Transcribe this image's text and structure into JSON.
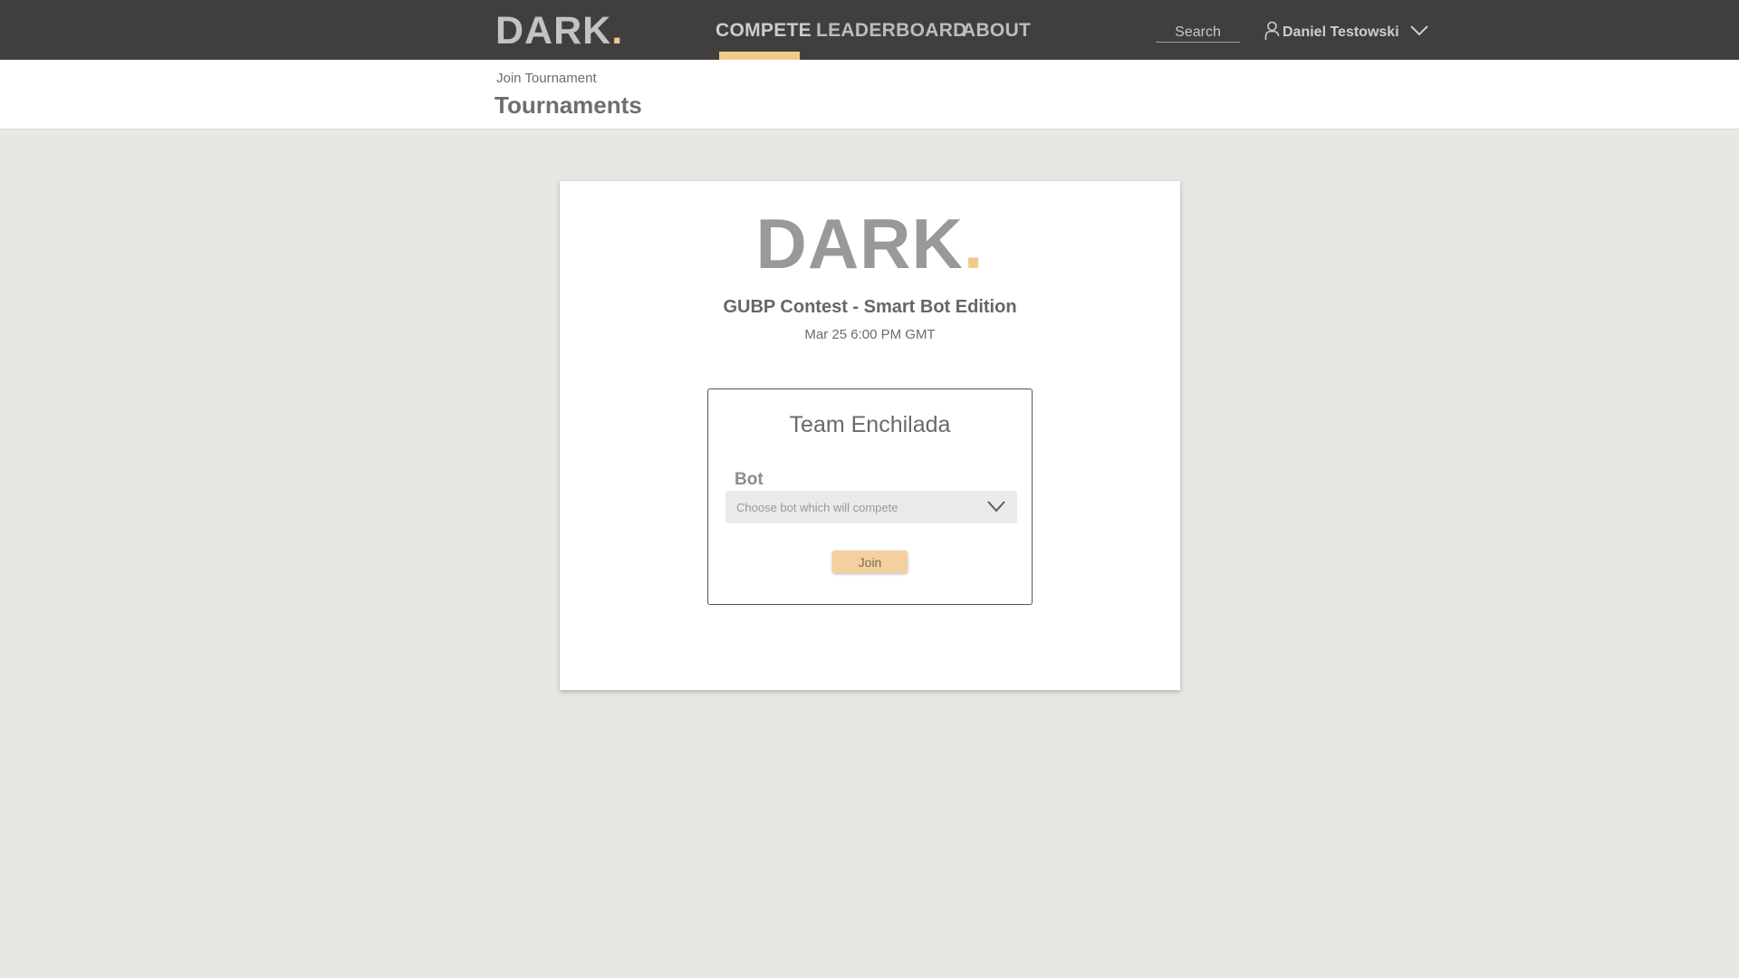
{
  "nav": {
    "logo_text": "DARK",
    "logo_dot": ".",
    "items": [
      {
        "label": "COMPETE",
        "active": true
      },
      {
        "label": "LEADERBOARD",
        "active": false
      },
      {
        "label": "ABOUT",
        "active": false
      }
    ],
    "search_placeholder": "Search",
    "user_icon": "user-icon",
    "user_name": "Daniel Testowski",
    "user_menu_icon": "chevron-down-icon"
  },
  "header": {
    "breadcrumb": "Join Tournament",
    "title": "Tournaments"
  },
  "card": {
    "logo_text": "DARK",
    "logo_dot": ".",
    "event_name": "GUBP Contest - Smart Bot Edition",
    "event_date": "Mar 25 6:00 PM GMT",
    "team_name": "Team Enchilada",
    "bot_label": "Bot",
    "bot_select_placeholder": "Choose bot which will compete",
    "bot_select_icon": "chevron-down-icon",
    "join_label": "Join"
  },
  "colors": {
    "topbar": "#403f3d",
    "accent": "#f2c98d",
    "background": "#e9e7e3",
    "join_button": "#f3d09e"
  }
}
